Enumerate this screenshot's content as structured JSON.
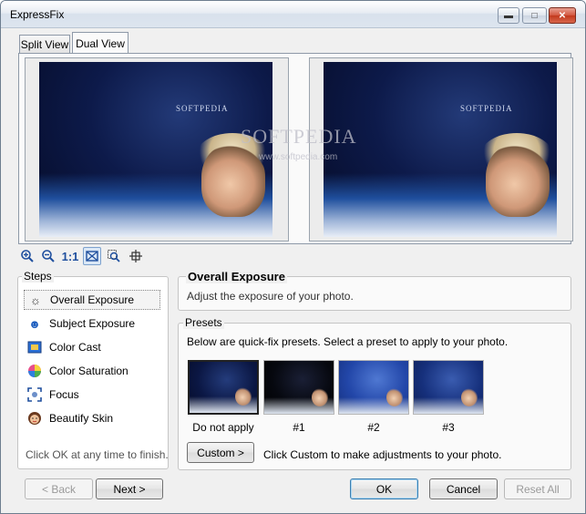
{
  "window": {
    "title": "ExpressFix",
    "controls": {
      "minimize_icon": "minimize-icon",
      "maximize_icon": "maximize-icon",
      "close_icon": "close-icon"
    }
  },
  "tabs": [
    {
      "label": "Split View",
      "active": false
    },
    {
      "label": "Dual View",
      "active": true
    }
  ],
  "preview": {
    "watermark": "SOFTPEDIA",
    "watermark_url": "www.softpedia.com"
  },
  "zoom_toolbar": [
    {
      "icon": "zoom-in-icon"
    },
    {
      "icon": "zoom-out-icon"
    },
    {
      "label": "1:1",
      "icon": "actual-size-icon"
    },
    {
      "icon": "fit-window-icon",
      "active": true
    },
    {
      "icon": "zoom-region-icon"
    },
    {
      "icon": "pan-icon"
    }
  ],
  "steps": {
    "label": "Steps",
    "items": [
      {
        "label": "Overall Exposure",
        "icon": "exposure-icon",
        "selected": true
      },
      {
        "label": "Subject Exposure",
        "icon": "subject-exposure-icon"
      },
      {
        "label": "Color Cast",
        "icon": "color-cast-icon"
      },
      {
        "label": "Color Saturation",
        "icon": "color-saturation-icon"
      },
      {
        "label": "Focus",
        "icon": "focus-icon"
      },
      {
        "label": "Beautify Skin",
        "icon": "beautify-skin-icon"
      }
    ],
    "note": "Click OK at any time to finish."
  },
  "exposure": {
    "title": "Overall Exposure",
    "description": "Adjust the exposure of your photo."
  },
  "presets": {
    "label": "Presets",
    "description": "Below are quick-fix presets. Select a preset to apply to your photo.",
    "items": [
      {
        "label": "Do not apply",
        "selected": true
      },
      {
        "label": "#1"
      },
      {
        "label": "#2"
      },
      {
        "label": "#3"
      }
    ],
    "custom_button": "Custom >",
    "custom_note": "Click Custom to make adjustments to your photo."
  },
  "footer": {
    "back": "< Back",
    "next": "Next >",
    "ok": "OK",
    "cancel": "Cancel",
    "reset_all": "Reset All"
  },
  "colors": {
    "accent": "#1f4f9e",
    "photo_dark": "#050b26",
    "close_button": "#c2391d"
  }
}
